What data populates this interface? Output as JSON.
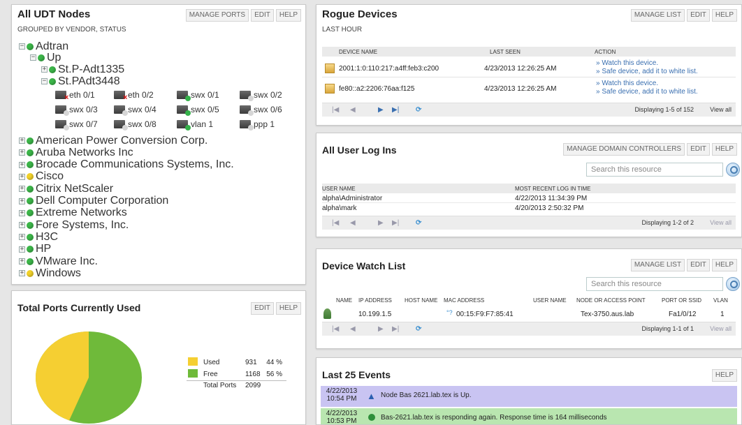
{
  "udt": {
    "title": "All UDT Nodes",
    "subtitle": "GROUPED BY VENDOR, STATUS",
    "buttons": {
      "manage_ports": "MANAGE PORTS",
      "edit": "EDIT",
      "help": "HELP"
    },
    "tree": {
      "adtran": "Adtran",
      "up": "Up",
      "node1": "St.P-Adt1335",
      "node2": "St.PAdt3448",
      "interfaces": [
        {
          "label": "eth 0/1",
          "status": "red"
        },
        {
          "label": "eth 0/2",
          "status": "red"
        },
        {
          "label": "swx 0/1",
          "status": "green"
        },
        {
          "label": "swx 0/2",
          "status": "grey"
        },
        {
          "label": "swx 0/3",
          "status": "grey"
        },
        {
          "label": "swx 0/4",
          "status": "grey"
        },
        {
          "label": "swx 0/5",
          "status": "green"
        },
        {
          "label": "swx 0/6",
          "status": "grey"
        },
        {
          "label": "swx 0/7",
          "status": "grey"
        },
        {
          "label": "swx 0/8",
          "status": "grey"
        },
        {
          "label": "vlan 1",
          "status": "green"
        },
        {
          "label": "ppp 1",
          "status": "grey"
        }
      ],
      "vendors": [
        {
          "label": "American Power Conversion Corp.",
          "status": "green"
        },
        {
          "label": "Aruba Networks Inc",
          "status": "green"
        },
        {
          "label": "Brocade Communications Systems, Inc.",
          "status": "green"
        },
        {
          "label": "Cisco",
          "status": "yellow"
        },
        {
          "label": "Citrix NetScaler",
          "status": "green"
        },
        {
          "label": "Dell Computer Corporation",
          "status": "green"
        },
        {
          "label": "Extreme Networks",
          "status": "green"
        },
        {
          "label": "Fore Systems, Inc.",
          "status": "green"
        },
        {
          "label": "H3C",
          "status": "green"
        },
        {
          "label": "HP",
          "status": "green"
        },
        {
          "label": "VMware Inc.",
          "status": "green"
        },
        {
          "label": "Windows",
          "status": "yellow"
        }
      ]
    }
  },
  "ports": {
    "title": "Total Ports Currently Used",
    "buttons": {
      "edit": "EDIT",
      "help": "HELP"
    },
    "legend": [
      {
        "label": "Used",
        "value": "931",
        "pct": "44 %",
        "color": "#f5cf32"
      },
      {
        "label": "Free",
        "value": "1168",
        "pct": "56 %",
        "color": "#6fba3a"
      }
    ],
    "total_label": "Total Ports",
    "total_value": "2099",
    "used_fraction": 0.44
  },
  "rogue": {
    "title": "Rogue Devices",
    "subtitle": "LAST HOUR",
    "buttons": {
      "manage_list": "MANAGE LIST",
      "edit": "EDIT",
      "help": "HELP"
    },
    "columns": [
      "DEVICE NAME",
      "LAST SEEN",
      "ACTION"
    ],
    "rows": [
      {
        "name": "2001:1:0:110:217:a4ff:feb3:c200",
        "seen": "4/23/2013 12:26:25 AM",
        "a1": "» Watch this device.",
        "a2": "» Safe device, add it to white list."
      },
      {
        "name": "fe80::a2:2206:76aa:f125",
        "seen": "4/23/2013 12:26:25 AM",
        "a1": "» Watch this device.",
        "a2": "» Safe device, add it to white list."
      }
    ],
    "displaying": "Displaying 1-5 of 152",
    "view_all": "View all"
  },
  "logins": {
    "title": "All User Log Ins",
    "buttons": {
      "manage": "MANAGE DOMAIN CONTROLLERS",
      "edit": "EDIT",
      "help": "HELP"
    },
    "search_placeholder": "Search this resource",
    "columns": [
      "USER NAME",
      "MOST RECENT LOG IN TIME"
    ],
    "rows": [
      {
        "user": "alpha\\Administrator",
        "time": "4/22/2013 11:34:39 PM"
      },
      {
        "user": "alpha\\mark",
        "time": "4/20/2013 2:50:32 PM"
      }
    ],
    "displaying": "Displaying 1-2 of 2",
    "view_all": "View all"
  },
  "watch": {
    "title": "Device Watch List",
    "buttons": {
      "manage": "MANAGE LIST",
      "edit": "EDIT",
      "help": "HELP"
    },
    "search_placeholder": "Search this resource",
    "columns": [
      "NAME",
      "IP ADDRESS",
      "HOST NAME",
      "MAC ADDRESS",
      "USER NAME",
      "NODE OR ACCESS POINT",
      "PORT OR SSID",
      "VLAN"
    ],
    "row": {
      "ip": "10.199.1.5",
      "mac": "00:15:F9:F7:85:41",
      "node": "Tex-3750.aus.lab",
      "port": "Fa1/0/12",
      "vlan": "1"
    },
    "displaying": "Displaying 1-1 of 1",
    "view_all": "View all"
  },
  "events": {
    "title": "Last 25 Events",
    "buttons": {
      "help": "HELP"
    },
    "items": [
      {
        "time": "4/22/2013 10:54 PM",
        "msg": "Node Bas 2621.lab.tex is Up.",
        "color": "#c9c4f2"
      },
      {
        "time": "4/22/2013 10:53 PM",
        "msg": "Bas-2621.lab.tex is responding again. Response time is 164 milliseconds",
        "color": "#b9e6b0"
      }
    ]
  }
}
